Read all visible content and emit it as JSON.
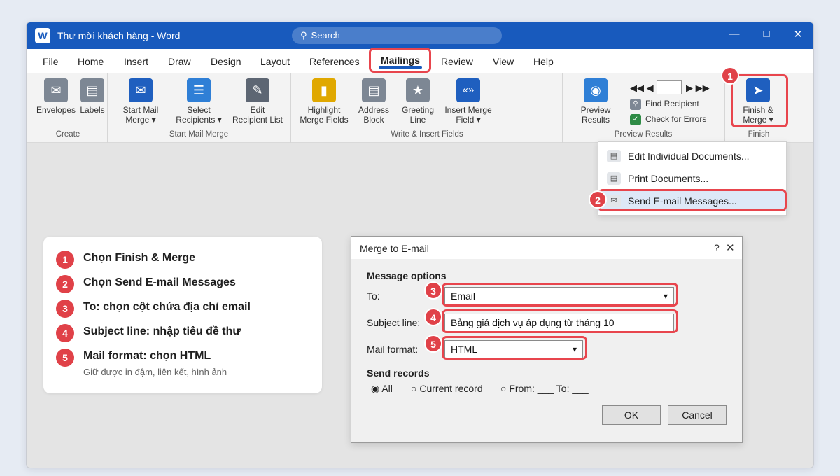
{
  "window": {
    "app_icon_letter": "W",
    "title": "Thư mời khách hàng - Word",
    "search_icon": "⚲",
    "search_placeholder": "Search",
    "controls": {
      "minimize": "—",
      "maximize": "□",
      "close": "✕"
    }
  },
  "tabs": [
    "File",
    "Home",
    "Insert",
    "Draw",
    "Design",
    "Layout",
    "References",
    "Mailings",
    "Review",
    "View",
    "Help"
  ],
  "active_tab": "Mailings",
  "ribbon": {
    "groups": {
      "create": "Create",
      "start_mail_merge": "Start Mail Merge",
      "write_insert": "Write & Insert Fields",
      "preview_results": "Preview Results",
      "finish": "Finish"
    },
    "buttons": {
      "envelopes": {
        "label": "Envelopes",
        "glyph": "✉"
      },
      "labels": {
        "label": "Labels",
        "glyph": "▤"
      },
      "start_mail_merge": {
        "line1": "Start Mail",
        "line2": "Merge ▾",
        "glyph": "✉"
      },
      "select_recipients": {
        "line1": "Select",
        "line2": "Recipients ▾",
        "glyph": "☰"
      },
      "edit_recipient_list": {
        "line1": "Edit",
        "line2": "Recipient List",
        "glyph": "✎"
      },
      "highlight_merge_fields": {
        "line1": "Highlight",
        "line2": "Merge Fields",
        "glyph": "▮"
      },
      "address_block": {
        "line1": "Address",
        "line2": "Block",
        "glyph": "▤"
      },
      "greeting_line": {
        "line1": "Greeting",
        "line2": "Line",
        "glyph": "★"
      },
      "insert_merge_field": {
        "line1": "Insert Merge",
        "line2": "Field ▾",
        "glyph": "«»"
      },
      "preview_results": {
        "line1": "Preview",
        "line2": "Results",
        "glyph": "◉"
      },
      "finish_merge": {
        "line1": "Finish &",
        "line2": "Merge ▾",
        "glyph": "➤"
      }
    },
    "nav": {
      "first_prev": "◀◀ ◀",
      "next_last": "▶ ▶▶"
    },
    "find_recipient": {
      "label": "Find Recipient",
      "glyph": "⚲"
    },
    "check_errors": {
      "label": "Check for Errors",
      "glyph": "✓"
    }
  },
  "finish_menu": [
    {
      "label": "Edit Individual Documents...",
      "glyph": "▤"
    },
    {
      "label": "Print Documents...",
      "glyph": "▤"
    },
    {
      "label": "Send E-mail Messages...",
      "glyph": "✉"
    }
  ],
  "badges": [
    "1",
    "2",
    "3",
    "4",
    "5"
  ],
  "steps": [
    {
      "num": "1",
      "text": "Chọn Finish & Merge"
    },
    {
      "num": "2",
      "text": "Chọn Send E-mail Messages"
    },
    {
      "num": "3",
      "text": "To: chọn cột chứa địa chỉ email"
    },
    {
      "num": "4",
      "text": "Subject line: nhập tiêu đề thư"
    },
    {
      "num": "5",
      "text": "Mail format: chọn HTML",
      "sub": "Giữ được in đậm, liên kết, hình ảnh"
    }
  ],
  "dialog": {
    "title": "Merge to E-mail",
    "help": "?",
    "close": "✕",
    "message_options": "Message options",
    "to_label": "To:",
    "to_value": "Email",
    "subject_label": "Subject line:",
    "subject_value": "Bảng giá dịch vụ áp dụng từ tháng 10",
    "format_label": "Mail format:",
    "format_value": "HTML",
    "caret": "▾",
    "send_records": "Send records",
    "radio_all": "◉ All",
    "radio_current": "○ Current record",
    "radio_from": "○ From: ___ To: ___",
    "ok": "OK",
    "cancel": "Cancel"
  },
  "colors": {
    "accent": "#185abd",
    "highlight": "#e8454d",
    "badge": "#e04148"
  }
}
